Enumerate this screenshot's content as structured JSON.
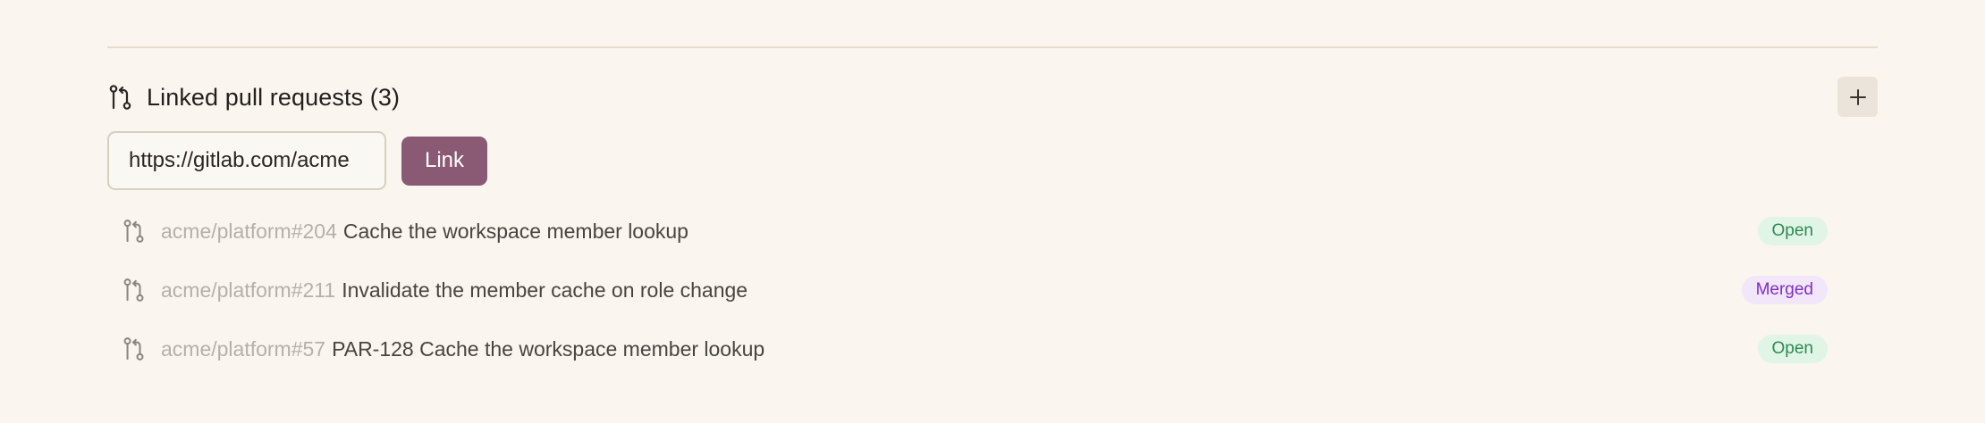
{
  "section": {
    "title": "Linked pull requests (3)",
    "add_button_label": "+",
    "icon": "git-pull-request-icon"
  },
  "link_form": {
    "input_value": "https://gitlab.com/acme",
    "button_label": "Link"
  },
  "pull_requests": [
    {
      "ref": "acme/platform#204",
      "title": "Cache the workspace member lookup",
      "status": "Open",
      "status_type": "open",
      "icon": "git-pull-request-icon"
    },
    {
      "ref": "acme/platform#211",
      "title": "Invalidate the member cache on role change",
      "status": "Merged",
      "status_type": "merged",
      "icon": "git-pull-request-icon"
    },
    {
      "ref": "acme/platform#57",
      "title": "PAR-128 Cache the workspace member lookup",
      "status": "Open",
      "status_type": "open",
      "icon": "git-pull-request-icon"
    }
  ],
  "colors": {
    "background": "#faf5ee",
    "accent": "#8a5a74",
    "open_bg": "#e1f5e7",
    "open_text": "#2e8a4e",
    "merged_bg": "#f2e6fb",
    "merged_text": "#7e2fc2"
  }
}
